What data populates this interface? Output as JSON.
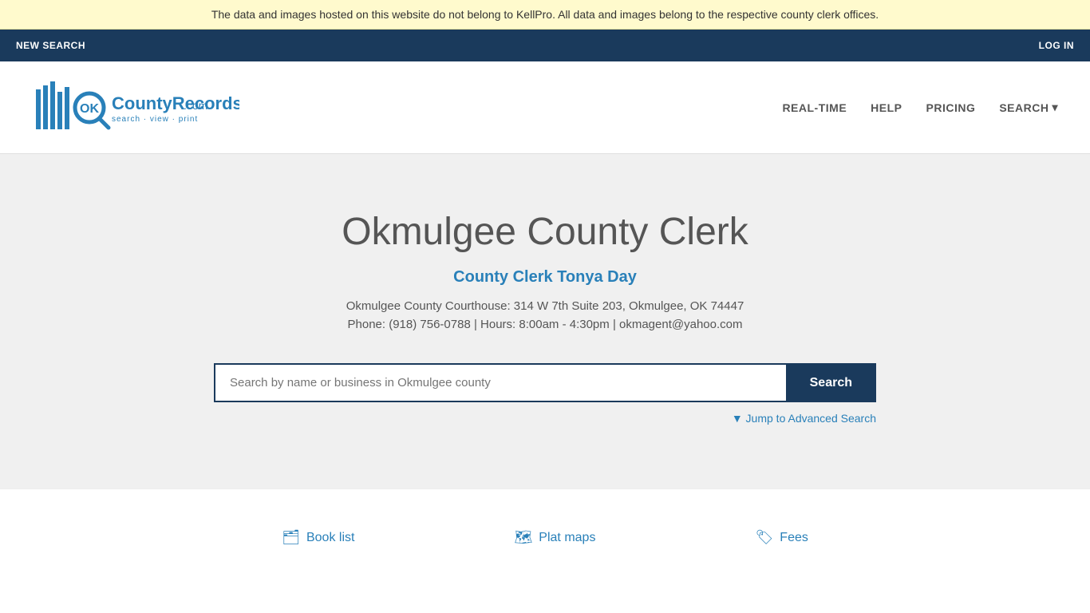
{
  "banner": {
    "text": "The data and images hosted on this website do not belong to KellPro. All data and images belong to the respective county clerk offices."
  },
  "topNav": {
    "newSearch": "NEW SEARCH",
    "logIn": "LOG IN"
  },
  "header": {
    "logoAlt": "OKCountyRecords.com",
    "logoTagline": "search · view · print",
    "nav": {
      "realtime": "REAL-TIME",
      "help": "HELP",
      "pricing": "PRICING",
      "search": "SEARCH"
    }
  },
  "hero": {
    "title": "Okmulgee County Clerk",
    "subtitle": "County Clerk Tonya Day",
    "address": "Okmulgee County Courthouse: 314 W 7th Suite 203, Okmulgee, OK 74447",
    "contact": "Phone: (918) 756-0788 | Hours: 8:00am - 4:30pm | okmagent@yahoo.com",
    "searchPlaceholder": "Search by name or business in Okmulgee county",
    "searchButton": "Search",
    "advancedSearch": "▼ Jump to Advanced Search"
  },
  "bottomLinks": {
    "bookList": "Book list",
    "platMaps": "Plat maps",
    "fees": "Fees"
  }
}
